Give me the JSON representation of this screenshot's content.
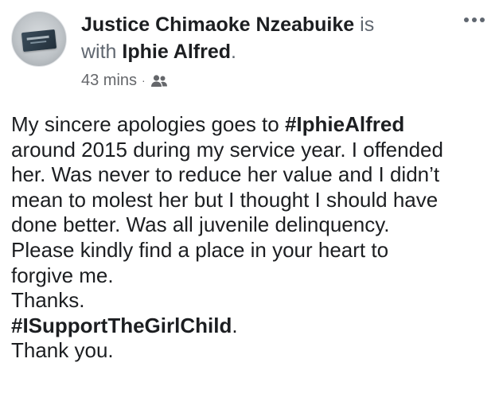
{
  "post": {
    "author": "Justice Chimaoke Nzeabuike",
    "is_text": " is",
    "with_text": "with ",
    "tagged": "Iphie Alfred",
    "period": ".",
    "time": "43 mins",
    "separator": "·",
    "audience_icon": "friends-icon",
    "more_icon": "more-horizontal-icon",
    "avatar_icon": "profile-photo",
    "body": {
      "line1_pre": "My sincere apologies goes to ",
      "line1_tag": "#IphieAlfred",
      "line2": "around 2015 during my service year. I offended",
      "line3": "her. Was never to reduce her value and I didn’t",
      "line4": "mean to molest her but I thought I should have",
      "line5": "done better. Was all juvenile delinquency.",
      "line6": "Please kindly find a place in your heart to",
      "line7": "forgive me.",
      "line8": "Thanks.",
      "line9_tag": "#ISupportTheGirlChild",
      "line9_post": ".",
      "line10": "Thank you."
    }
  },
  "colors": {
    "text": "#1c1e21",
    "secondary": "#65676b",
    "background": "#ffffff"
  }
}
